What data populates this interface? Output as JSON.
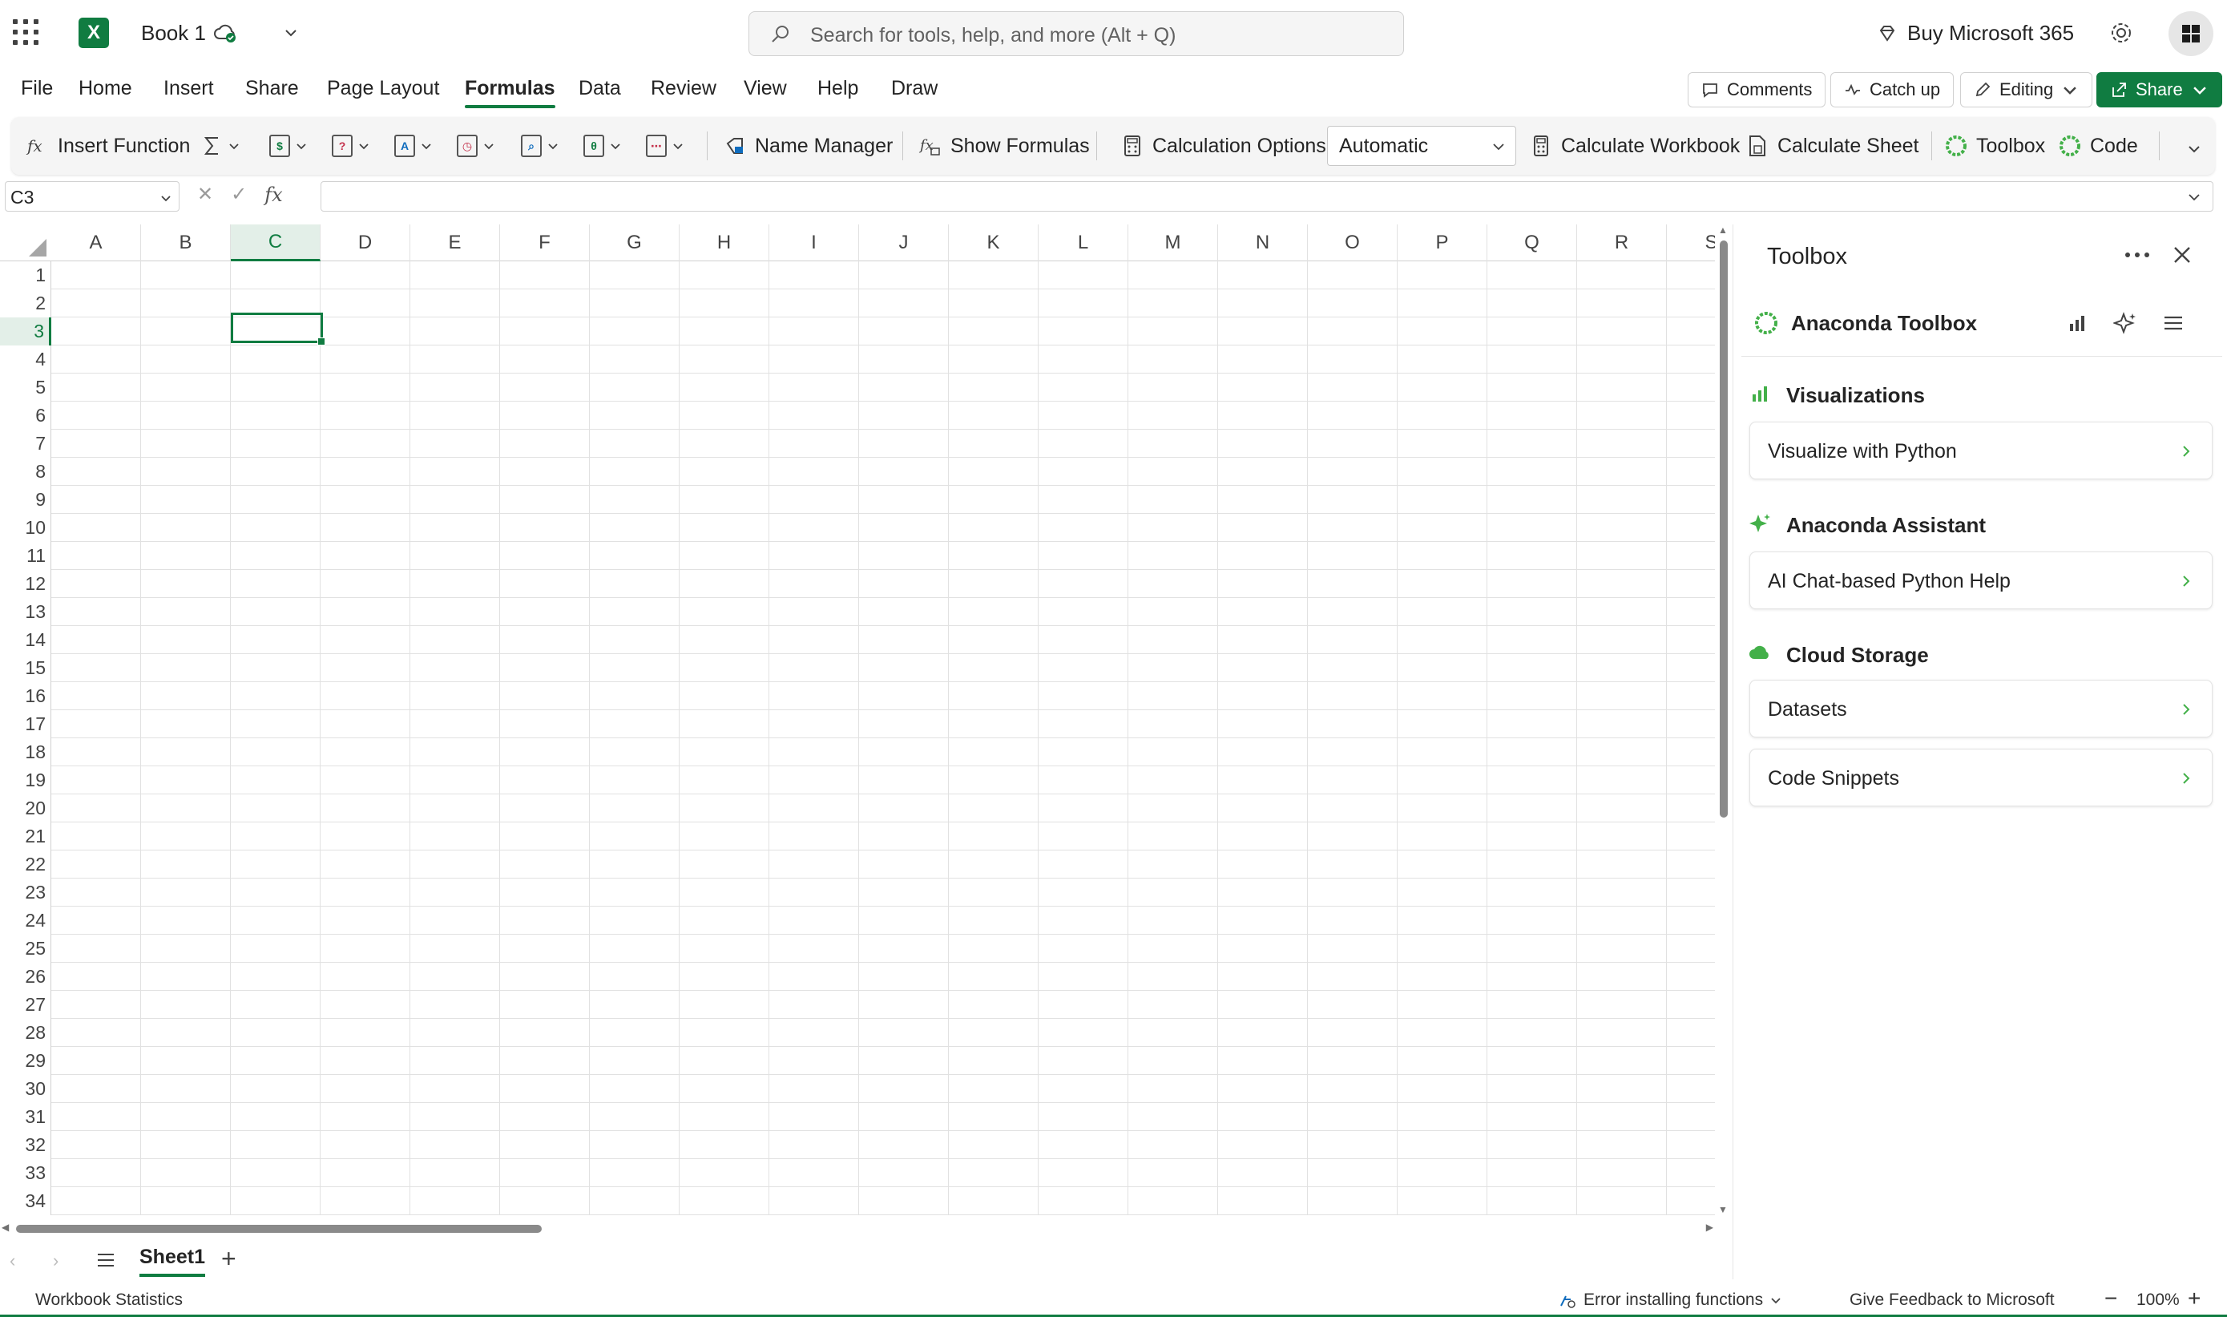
{
  "app": {
    "book_title": "Book 1",
    "search_placeholder": "Search for tools, help, and more (Alt + Q)",
    "buy_label": "Buy Microsoft 365",
    "logo_letter": "X",
    "accent_color": "#107c41"
  },
  "menu": {
    "tabs": [
      "File",
      "Home",
      "Insert",
      "Share",
      "Page Layout",
      "Formulas",
      "Data",
      "Review",
      "View",
      "Help",
      "Draw"
    ],
    "active_tab": "Formulas",
    "comments_label": "Comments",
    "catchup_label": "Catch up",
    "editing_label": "Editing",
    "share_label": "Share"
  },
  "ribbon": {
    "insert_function": "Insert Function",
    "name_manager": "Name Manager",
    "show_formulas": "Show Formulas",
    "calculation_options": "Calculation Options",
    "calculation_mode": "Automatic",
    "calculate_workbook": "Calculate Workbook",
    "calculate_sheet": "Calculate Sheet",
    "toolbox": "Toolbox",
    "code": "Code"
  },
  "formula_bar": {
    "name_box": "C3",
    "fx": "fx",
    "value": ""
  },
  "grid": {
    "columns": [
      "A",
      "B",
      "C",
      "D",
      "E",
      "F",
      "G",
      "H",
      "I",
      "J",
      "K",
      "L",
      "M",
      "N",
      "O",
      "P",
      "Q",
      "R",
      "S"
    ],
    "rows": [
      "1",
      "2",
      "3",
      "4",
      "5",
      "6",
      "7",
      "8",
      "9",
      "10",
      "11",
      "12",
      "13",
      "14",
      "15",
      "16",
      "17",
      "18",
      "19",
      "20",
      "21",
      "22",
      "23",
      "24",
      "25",
      "26",
      "27",
      "28",
      "29",
      "30",
      "31",
      "32",
      "33",
      "34"
    ],
    "selected_column": "C",
    "selected_row": "3"
  },
  "sheets": {
    "tabs": [
      "Sheet1"
    ],
    "active": "Sheet1"
  },
  "status": {
    "workbook_statistics": "Workbook Statistics",
    "error": "Error installing functions",
    "feedback": "Give Feedback to Microsoft",
    "zoom": "100%"
  },
  "pane": {
    "title": "Toolbox",
    "addin_title": "Anaconda Toolbox",
    "sections": [
      {
        "title": "Visualizations",
        "icon": "bar-chart-icon",
        "cards": [
          "Visualize with Python"
        ]
      },
      {
        "title": "Anaconda Assistant",
        "icon": "sparkle-icon",
        "cards": [
          "AI Chat-based Python Help"
        ]
      },
      {
        "title": "Cloud Storage",
        "icon": "cloud-icon",
        "cards": [
          "Datasets",
          "Code Snippets"
        ]
      }
    ]
  }
}
